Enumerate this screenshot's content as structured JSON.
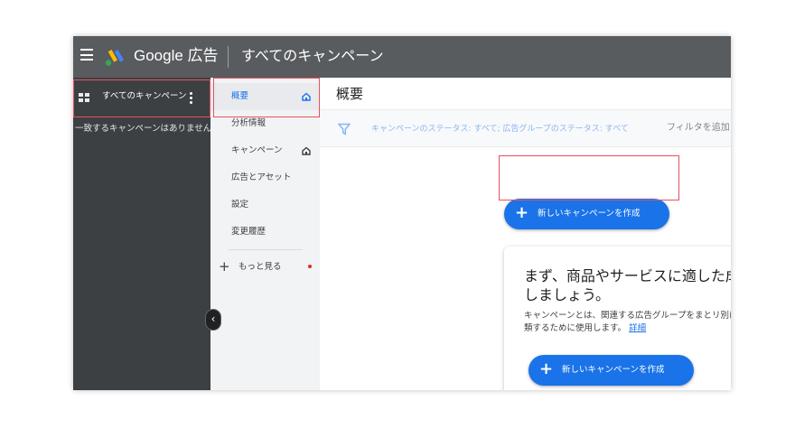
{
  "topbar": {
    "brand": "Google 広告",
    "section": "すべてのキャンペーン"
  },
  "sidebar": {
    "all_campaigns": "すべてのキャンペーン",
    "empty": "一致するキャンペーンはありません"
  },
  "nav": {
    "items": [
      {
        "label": "概要"
      },
      {
        "label": "分析情報"
      },
      {
        "label": "キャンペーン"
      },
      {
        "label": "広告とアセット"
      },
      {
        "label": "設定"
      },
      {
        "label": "変更履歴"
      }
    ],
    "more": "もっと見る"
  },
  "main": {
    "title": "概要",
    "filter_text": "キャンペーンのステータス: すべて; 広告グループのステータス: すべて",
    "filter_add": "フィルタを追加",
    "new_campaign_button": "新しいキャンペーンを作成",
    "card": {
      "heading": "まず、商品やサービスに適した成しましょう。",
      "body": "キャンペーンとは、関連する広告グループをまとリ別に分類するために使用します。",
      "link": "詳細",
      "button": "新しいキャンペーンを作成"
    }
  },
  "colors": {
    "topbar": "#595c5f",
    "sidebar": "#3c4043",
    "accent": "#1a73e8",
    "highlight": "#e8505b"
  }
}
